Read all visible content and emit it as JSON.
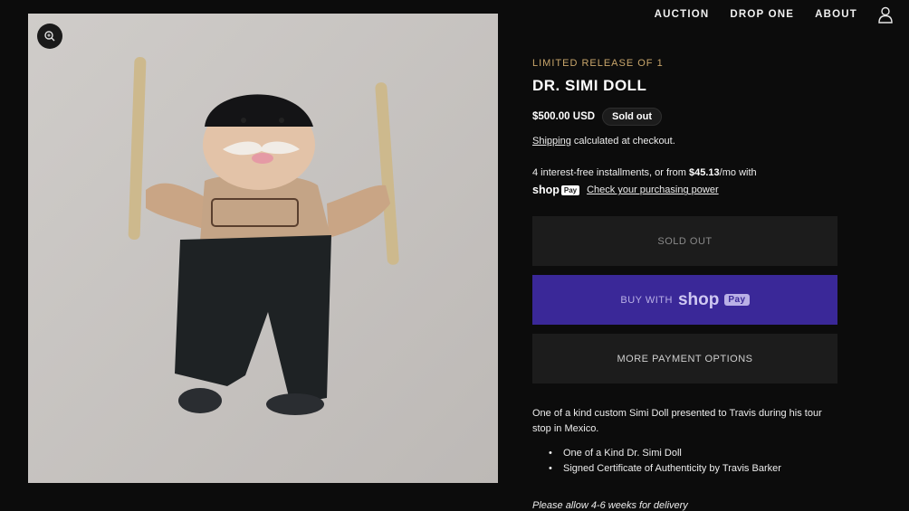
{
  "nav": {
    "items": [
      {
        "label": "AUCTION"
      },
      {
        "label": "DROP ONE"
      },
      {
        "label": "ABOUT"
      }
    ],
    "account_icon": "user-icon"
  },
  "media": {
    "zoom_icon": "zoom-icon"
  },
  "product": {
    "eyebrow": "LIMITED RELEASE OF 1",
    "title": "DR. SIMI DOLL",
    "price": "$500.00 USD",
    "badge": "Sold out",
    "shipping_link": "Shipping",
    "shipping_text": " calculated at checkout.",
    "install_prefix": "4 interest-free installments, or from ",
    "install_amount": "$45.13",
    "install_suffix": "/mo with",
    "install_shop": "shop",
    "install_pay": "Pay",
    "install_link": "Check your purchasing power",
    "buttons": {
      "sold_out": "SOLD OUT",
      "buy_prefix": "BUY WITH",
      "buy_shop": "shop",
      "buy_pay": "Pay",
      "more": "MORE PAYMENT OPTIONS"
    },
    "description": "One of a kind custom Simi Doll presented to Travis during his tour stop in Mexico.",
    "bullets": [
      "One of a Kind Dr. Simi Doll",
      "Signed Certificate of Authenticity by Travis Barker"
    ],
    "note": "Please allow 4-6 weeks for delivery"
  },
  "colors": {
    "background": "#0c0c0c",
    "accent_gold": "#c9a66b",
    "shop_purple": "#3a2898"
  }
}
